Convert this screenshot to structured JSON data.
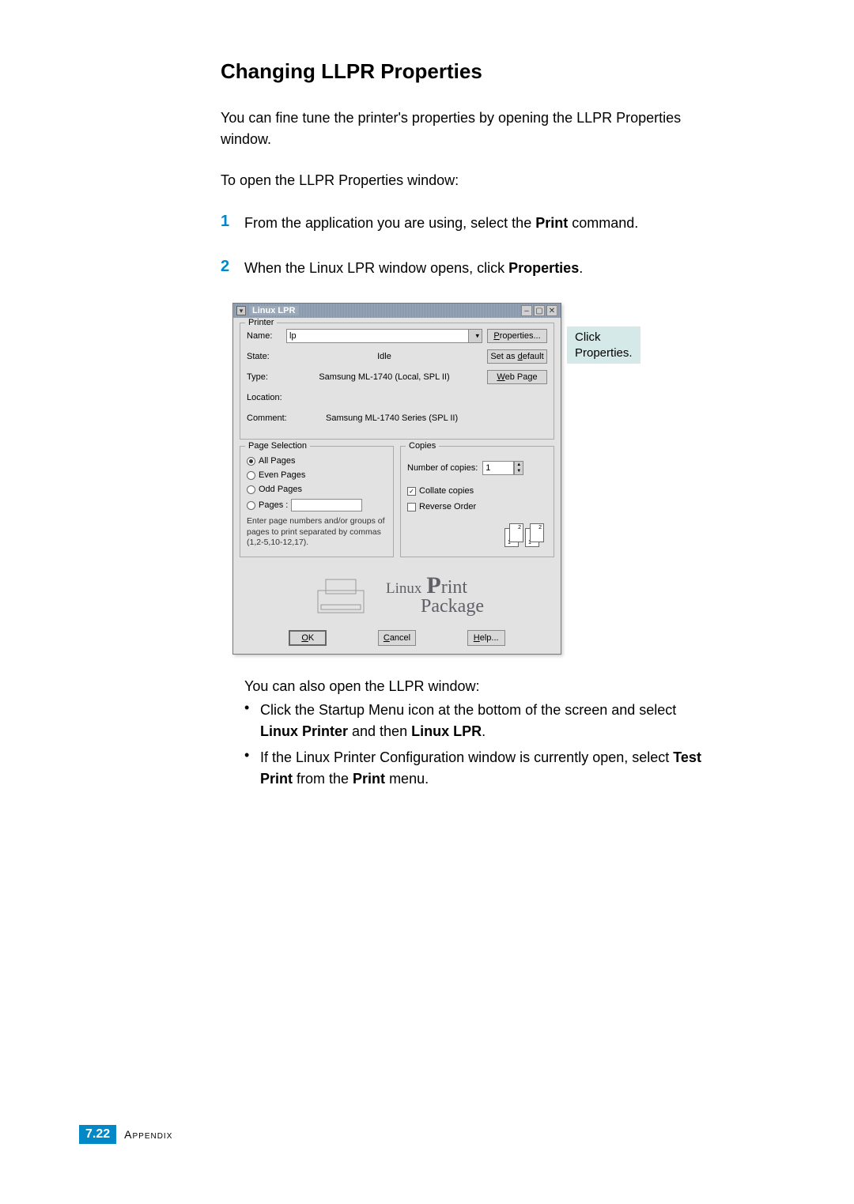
{
  "page_title": "Changing LLPR Properties",
  "intro": "You can fine tune the printer's properties by opening the LLPR Properties window.",
  "instruction": "To open the LLPR Properties window:",
  "steps": [
    {
      "num": "1",
      "prefix": "From the application you are using, select the ",
      "bold": "Print",
      "suffix": " command."
    },
    {
      "num": "2",
      "prefix": "When the Linux LPR window opens, click ",
      "bold": "Properties",
      "suffix": "."
    }
  ],
  "dialog": {
    "title": "Linux LPR",
    "printer_section": "Printer",
    "name_label": "Name:",
    "name_value": "lp",
    "state_label": "State:",
    "state_value": "Idle",
    "type_label": "Type:",
    "type_value": "Samsung ML-1740 (Local, SPL II)",
    "location_label": "Location:",
    "location_value": "",
    "comment_label": "Comment:",
    "comment_value": "Samsung ML-1740 Series (SPL II)",
    "btn_properties": "Properties...",
    "btn_default": "Set as default",
    "btn_webpage": "Web Page",
    "page_selection_section": "Page Selection",
    "radio_all": "All Pages",
    "radio_even": "Even Pages",
    "radio_odd": "Odd Pages",
    "radio_pages": "Pages :",
    "pages_help": "Enter page numbers and/or groups of pages to print separated by commas (1,2-5,10-12,17).",
    "copies_section": "Copies",
    "copies_label": "Number of copies:",
    "copies_value": "1",
    "collate_label": "Collate copies",
    "reverse_label": "Reverse Order",
    "logo_linux": "Linux",
    "logo_print": "Print",
    "logo_package": "Package",
    "btn_ok": "OK",
    "btn_cancel": "Cancel",
    "btn_help": "Help..."
  },
  "callout_line1": "Click",
  "callout_line2": "Properties.",
  "post_intro": "You can also open the LLPR window:",
  "bullets": [
    {
      "pre": "Click the Startup Menu icon at the bottom of the screen and select ",
      "b1": "Linux Printer",
      "mid": " and then ",
      "b2": "Linux LPR",
      "post": "."
    },
    {
      "pre": "If the Linux Printer Configuration window is currently open, select ",
      "b1": "Test Print",
      "mid": " from the ",
      "b2": "Print",
      "post": " menu."
    }
  ],
  "footer": {
    "chapter": "7.",
    "page": "22",
    "label": "Appendix"
  }
}
